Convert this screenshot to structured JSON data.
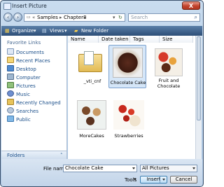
{
  "window": {
    "title": "Insert Picture",
    "close_glyph": "X"
  },
  "address": {
    "segments": [
      "Samples",
      "Chapter8"
    ],
    "search_placeholder": "Search"
  },
  "toolbar": {
    "organize": "Organize",
    "views": "Views",
    "new_folder": "New Folder"
  },
  "sidebar": {
    "header": "Favorite Links",
    "items": [
      {
        "label": "Documents",
        "icon": "documents-icon"
      },
      {
        "label": "Recent Places",
        "icon": "recent-places-icon"
      },
      {
        "label": "Desktop",
        "icon": "desktop-icon"
      },
      {
        "label": "Computer",
        "icon": "computer-icon"
      },
      {
        "label": "Pictures",
        "icon": "pictures-icon"
      },
      {
        "label": "Music",
        "icon": "music-icon"
      },
      {
        "label": "Recently Changed",
        "icon": "recently-changed-icon"
      },
      {
        "label": "Searches",
        "icon": "searches-icon"
      },
      {
        "label": "Public",
        "icon": "public-icon"
      }
    ],
    "folders_label": "Folders"
  },
  "columns": [
    "Name",
    "Date taken",
    "Tags",
    "Size"
  ],
  "files": [
    {
      "name": "_vti_cnf",
      "kind": "folder"
    },
    {
      "name": "Chocolate Cake",
      "kind": "image",
      "selected": true
    },
    {
      "name": "Fruit and Chocolate",
      "kind": "image"
    },
    {
      "name": "MoreCakes",
      "kind": "image"
    },
    {
      "name": "Strawberries",
      "kind": "image"
    }
  ],
  "footer": {
    "file_name_label": "File name:",
    "file_name_value": "Chocolate Cake",
    "filter_value": "All Pictures",
    "tools_label": "Tools",
    "insert_label": "Insert",
    "cancel_label": "Cancel"
  }
}
